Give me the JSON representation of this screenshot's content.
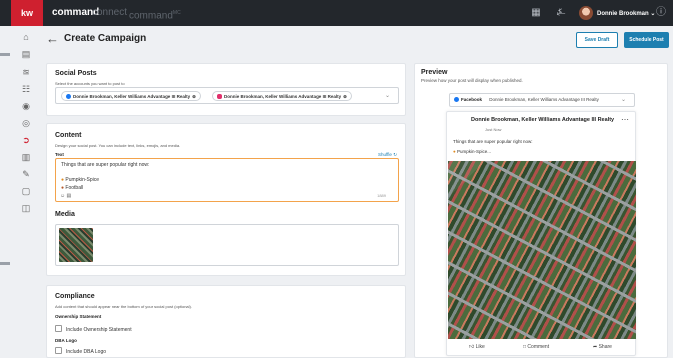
{
  "topbar": {
    "logo": "kw",
    "app_tabs": [
      "command",
      "connect",
      "command"
    ],
    "mc_sup": "MC",
    "user_name": "Donnie Brookman",
    "icons": [
      "grid-icon",
      "bell-icon",
      "avatar",
      "help-icon"
    ]
  },
  "sidebar": {
    "icons": [
      "home-icon",
      "contacts-icon",
      "opportunities-icon",
      "tasks-icon",
      "properties-icon",
      "marketing-icon",
      "campaigns-icon",
      "insights-icon",
      "notes-icon",
      "designs-icon",
      "website-icon"
    ],
    "active": "campaigns-icon"
  },
  "header": {
    "title": "Create Campaign",
    "save_draft": "Save Draft",
    "schedule_post": "Schedule Post"
  },
  "social_posts": {
    "title": "Social Posts",
    "subtitle": "Select the accounts you want to post to",
    "accounts": [
      {
        "platform": "facebook",
        "label": "Donnie Brookman, Keller Williams Advantage III Realty"
      },
      {
        "platform": "instagram",
        "label": "Donnie Brookman, Keller Williams Advantage III Realty"
      }
    ]
  },
  "content": {
    "title": "Content",
    "subtitle": "Design your social post. You can include text, links, emojis, and media.",
    "text_label": "Text",
    "shuffle_label": "Shuffle",
    "text_lines": [
      "Things that are super popular right now:",
      "Pumpkin-Spice",
      "Football"
    ],
    "char_count": "1889",
    "media_label": "Media"
  },
  "compliance": {
    "title": "Compliance",
    "subtitle": "Add content that should appear near the bottom of your social post (optional).",
    "ownership_label": "Ownership Statement",
    "ownership_option": "Include Ownership Statement",
    "dba_label": "DBA Logo",
    "dba_option": "Include DBA Logo"
  },
  "preview": {
    "title": "Preview",
    "subtitle": "Preview how your post will display when published.",
    "platform": "Facebook",
    "account": "Donnie Brookman, Keller Williams Advantage III Realty",
    "post_name": "Donnie Brookman, Keller Williams Advantage III Realty",
    "post_time": "Just Now",
    "post_text1": "Things that are super popular right now:",
    "post_text2": "Pumpkin-Spice...",
    "actions": [
      "Like",
      "Comment",
      "Share"
    ]
  }
}
